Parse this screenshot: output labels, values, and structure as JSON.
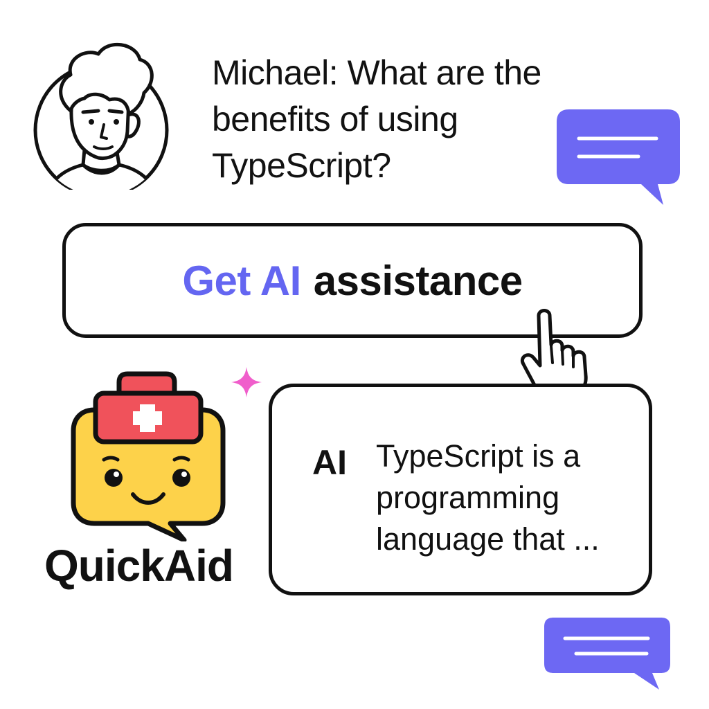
{
  "question": {
    "line1": "Michael: What are the",
    "line2": "benefits of using",
    "line3": "TypeScript?"
  },
  "cta": {
    "accent_text": "Get AI",
    "rest_text": "assistance"
  },
  "brand": {
    "name": "QuickAid"
  },
  "answer": {
    "label": "AI",
    "line1": "TypeScript is a",
    "line2": "programming",
    "line3": "language that ..."
  },
  "icons": {
    "avatar": "user-avatar-icon",
    "chat_top": "chat-bubble-icon",
    "chat_bottom": "chat-bubble-icon",
    "pointer": "hand-pointer-icon",
    "sparkle": "sparkle-icon",
    "mascot": "medical-chat-mascot-icon"
  },
  "colors": {
    "accent": "#6466f1",
    "chat_bubble": "#6d68f3",
    "mascot_face": "#fdd24a",
    "medkit": "#f0525b",
    "sparkle": "#f05ecb",
    "text": "#111111"
  }
}
